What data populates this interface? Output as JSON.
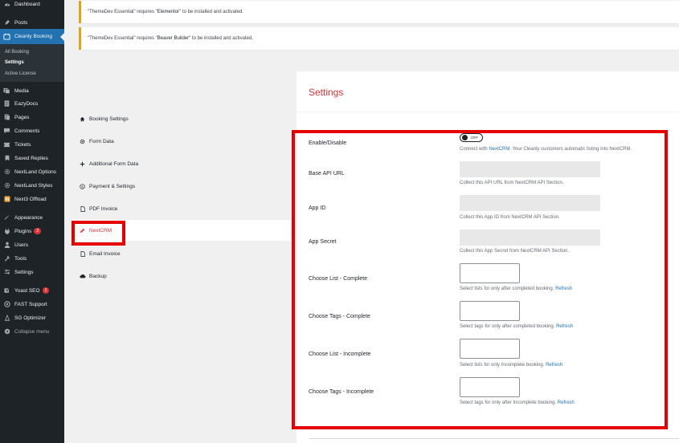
{
  "sidebar": {
    "items": [
      {
        "label": "Dashboard",
        "icon": "dashboard-icon"
      },
      {
        "label": "Posts",
        "icon": "pin-icon"
      },
      {
        "label": "Cleanly Booking",
        "icon": "booking-icon"
      },
      {
        "label": "Media",
        "icon": "media-icon"
      },
      {
        "label": "EazyDocs",
        "icon": "docs-icon"
      },
      {
        "label": "Pages",
        "icon": "pages-icon"
      },
      {
        "label": "Comments",
        "icon": "comments-icon"
      },
      {
        "label": "Tickets",
        "icon": "tickets-icon"
      },
      {
        "label": "Saved Replies",
        "icon": "replies-icon"
      },
      {
        "label": "NextLand Options",
        "icon": "gear-icon"
      },
      {
        "label": "NextLand Styles",
        "icon": "gear-icon"
      },
      {
        "label": "Next3 Offload",
        "icon": "offload-icon"
      },
      {
        "label": "Appearance",
        "icon": "appearance-icon"
      },
      {
        "label": "Plugins",
        "icon": "plugins-icon",
        "badge": "2"
      },
      {
        "label": "Users",
        "icon": "users-icon"
      },
      {
        "label": "Tools",
        "icon": "tools-icon"
      },
      {
        "label": "Settings",
        "icon": "settings-icon"
      },
      {
        "label": "Yoast SEO",
        "icon": "yoast-icon",
        "badge": "1"
      },
      {
        "label": "FAST Support",
        "icon": "support-icon"
      },
      {
        "label": "SG Optimizer",
        "icon": "optimizer-icon"
      },
      {
        "label": "Collapse menu",
        "icon": "collapse-icon"
      }
    ],
    "submenu": [
      "All Booking",
      "Settings",
      "Active License"
    ]
  },
  "notices": [
    {
      "pre": "\"ThemeDev Essential\" requires \"",
      "strong": "Elementor",
      "post": "\" to be installed and activated."
    },
    {
      "pre": "\"ThemeDev Essential\" requires \"",
      "strong": "Beaver Builder",
      "post": "\" to be installed and activated."
    }
  ],
  "tabs": [
    {
      "label": "Booking Settings",
      "icon": "home-icon"
    },
    {
      "label": "Form Data",
      "icon": "gear-icon"
    },
    {
      "label": "Additional Form Data",
      "icon": "plus-icon"
    },
    {
      "label": "Payment & Settings",
      "icon": "dollar-icon"
    },
    {
      "label": "PDF Invoice",
      "icon": "file-icon"
    },
    {
      "label": "NextCRM",
      "icon": "crm-icon"
    },
    {
      "label": "Email Invoice",
      "icon": "file-icon"
    },
    {
      "label": "Backup",
      "icon": "cloud-icon"
    }
  ],
  "panel": {
    "title": "Settings",
    "toggle": {
      "label": "Enable/Disable",
      "state": "OFF",
      "help_pre": "Connect with ",
      "help_link": "NextCRM",
      "help_post": ". Your Cleanly customers automatic listing into NextCRM."
    },
    "fields": [
      {
        "label": "Base API URL",
        "help": "Collect this API URL from NextCRM API Section."
      },
      {
        "label": "App ID",
        "help": "Collect this App ID from NextCRM API Section."
      },
      {
        "label": "App Secret",
        "help": "Collect this App Secret from NextCRM API Section."
      }
    ],
    "selects": [
      {
        "label": "Choose List - Complete",
        "help": "Select lists for only after completed booking.",
        "link": "Refresh"
      },
      {
        "label": "Choose Tags - Complete",
        "help": "Select tags for only after completed booking.",
        "link": "Refresh"
      },
      {
        "label": "Choose List - Incomplete",
        "help": "Select lists for only Incomplete booking.",
        "link": "Refresh"
      },
      {
        "label": "Choose Tags - Incomplete",
        "help": "Select tags for only after Incomplete booking.",
        "link": "Refresh"
      }
    ]
  },
  "colors": {
    "sidebar": "#1d2327",
    "active": "#2271b1",
    "accent": "#d63638",
    "highlight": "#e60000"
  }
}
